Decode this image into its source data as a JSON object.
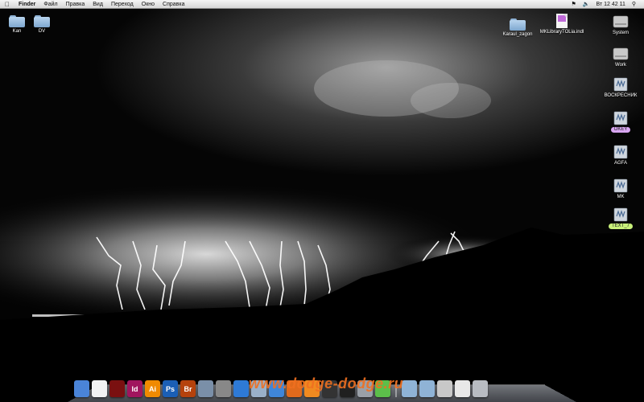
{
  "menubar": {
    "app": "Finder",
    "items": [
      "Файл",
      "Правка",
      "Вид",
      "Переход",
      "Окно",
      "Справка"
    ],
    "clock": "Вт 12 42 11"
  },
  "desktop": {
    "left_icons": [
      {
        "label": "Kan"
      },
      {
        "label": "DV"
      }
    ],
    "top_icons": [
      {
        "label": "Karaul_zagon"
      },
      {
        "label": "MKLibraryTOLia.indl"
      }
    ],
    "volumes": [
      {
        "label": "System",
        "kind": "hard-drive"
      },
      {
        "label": "Work",
        "kind": "hard-drive"
      },
      {
        "label": "ВОСКРЕСНИК",
        "kind": "network"
      },
      {
        "label": "OKEY",
        "kind": "network",
        "label_color": "#d9a6f2"
      },
      {
        "label": "AGFA",
        "kind": "network"
      },
      {
        "label": "MK",
        "kind": "network"
      },
      {
        "label": "TEXT_7",
        "kind": "network",
        "label_color": "#c8f07a"
      }
    ]
  },
  "dock": {
    "items": [
      {
        "icon": "finder-icon",
        "text": "",
        "color": "#4a84d8"
      },
      {
        "icon": "acrobat-reader-icon",
        "text": "",
        "color": "#f2f2f2"
      },
      {
        "icon": "acrobat-pro-icon",
        "text": "",
        "color": "#7a1010"
      },
      {
        "icon": "indesign-icon",
        "text": "Id",
        "color": "#a0155e"
      },
      {
        "icon": "illustrator-icon",
        "text": "Ai",
        "color": "#f08a00"
      },
      {
        "icon": "photoshop-icon",
        "text": "Ps",
        "color": "#1b5fb5"
      },
      {
        "icon": "bridge-icon",
        "text": "Br",
        "color": "#b5420c"
      },
      {
        "icon": "preview-icon",
        "text": "",
        "color": "#7a8fa8"
      },
      {
        "icon": "system-prefs-icon",
        "text": "",
        "color": "#888888"
      },
      {
        "icon": "safari-icon",
        "text": "",
        "color": "#2e7ad6"
      },
      {
        "icon": "mail-icon",
        "text": "",
        "color": "#9ab0c8"
      },
      {
        "icon": "itunes-icon",
        "text": "",
        "color": "#3f86d9"
      },
      {
        "icon": "firefox-icon",
        "text": "",
        "color": "#e06a1c"
      },
      {
        "icon": "vlc-icon",
        "text": "",
        "color": "#f08a20"
      },
      {
        "icon": "terminal-icon",
        "text": "",
        "color": "#333333"
      },
      {
        "icon": "dashboard-icon",
        "text": "",
        "color": "#202020"
      },
      {
        "icon": "disk-utility-icon",
        "text": "",
        "color": "#9aa0a8"
      },
      {
        "icon": "ichat-icon",
        "text": "",
        "color": "#5cbf4a"
      },
      {
        "icon": "folder-icon",
        "text": "",
        "color": "#8fb3d6"
      },
      {
        "icon": "folder-icon",
        "text": "",
        "color": "#8fb3d6"
      },
      {
        "icon": "drive-icon",
        "text": "",
        "color": "#c8c8c8"
      },
      {
        "icon": "document-icon",
        "text": "",
        "color": "#e8e8e8"
      },
      {
        "icon": "trash-icon",
        "text": "",
        "color": "#b8bcc2"
      }
    ]
  },
  "watermark": "www.dodge-dodge.ru"
}
